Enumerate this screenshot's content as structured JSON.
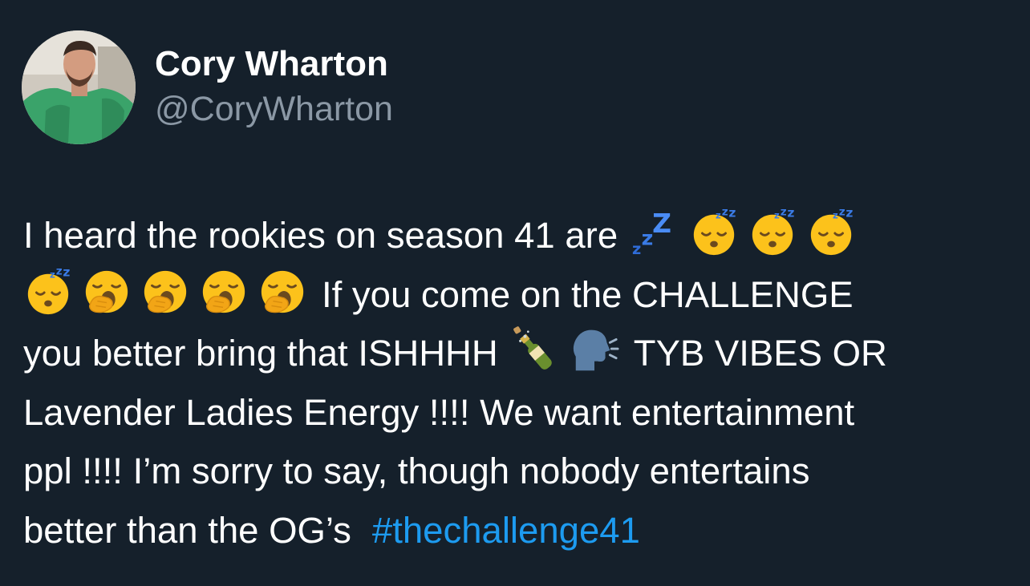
{
  "author": {
    "display_name": "Cory Wharton",
    "handle": "@CoryWharton"
  },
  "tweet": {
    "segments": {
      "s1": "I heard the rookies on season 41 are",
      "s2": "If you come on the CHALLENGE",
      "s3": "you better bring that ISHHHH",
      "s4": "TYB VIBES OR",
      "s5": "Lavender Ladies Energy !!!! We want entertainment",
      "s6": "ppl !!!! I’m sorry to say, though nobody entertains",
      "s7": "better than the OG’s",
      "hashtag": "#thechallenge41"
    },
    "emojis": [
      "zzz",
      "sleeping-face",
      "sleeping-face",
      "sleeping-face",
      "sleeping-face",
      "yawning-face",
      "yawning-face",
      "yawning-face",
      "yawning-face",
      "bottle-popping-cork",
      "speaking-head"
    ]
  },
  "colors": {
    "background": "#15202b",
    "text": "#ffffff",
    "handle": "#8b98a5",
    "hashtag": "#1d9bf0"
  }
}
